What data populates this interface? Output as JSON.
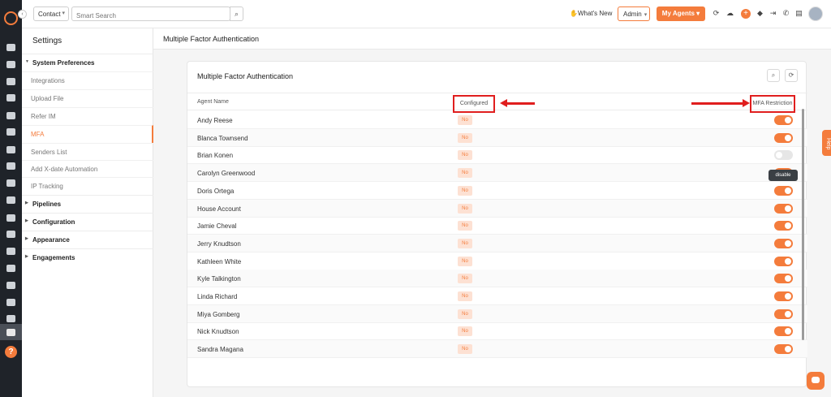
{
  "topbar": {
    "contact_label": "Contact",
    "search_placeholder": "Smart Search",
    "whats_new": "What's New",
    "admin_label": "Admin",
    "my_agents_label": "My Agents"
  },
  "sidebar": {
    "title": "Settings",
    "groups": [
      {
        "label": "System Preferences"
      },
      {
        "label": "Pipelines"
      },
      {
        "label": "Configuration"
      },
      {
        "label": "Appearance"
      },
      {
        "label": "Engagements"
      }
    ],
    "items": [
      {
        "label": "Integrations"
      },
      {
        "label": "Upload File"
      },
      {
        "label": "Refer IM"
      },
      {
        "label": "MFA"
      },
      {
        "label": "Senders List"
      },
      {
        "label": "Add X-date Automation"
      },
      {
        "label": "IP Tracking"
      }
    ]
  },
  "page": {
    "header": "Multiple Factor Authentication",
    "card_title": "Multiple Factor Authentication"
  },
  "table": {
    "headers": {
      "agent": "Agent Name",
      "configured": "Configured",
      "mfa": "MFA Restriction"
    },
    "rows": [
      {
        "name": "Andy Reese",
        "configured": "No",
        "mfa": true
      },
      {
        "name": "Blanca Townsend",
        "configured": "No",
        "mfa": true
      },
      {
        "name": "Brian Konen",
        "configured": "No",
        "mfa": false
      },
      {
        "name": "Carolyn Greenwood",
        "configured": "No",
        "mfa": true
      },
      {
        "name": "Doris Ortega",
        "configured": "No",
        "mfa": true
      },
      {
        "name": "House Account",
        "configured": "No",
        "mfa": true
      },
      {
        "name": "Jamie Cheval",
        "configured": "No",
        "mfa": true
      },
      {
        "name": "Jerry Knudtson",
        "configured": "No",
        "mfa": true
      },
      {
        "name": "Kathleen White",
        "configured": "No",
        "mfa": true
      },
      {
        "name": "Kyle Talkington",
        "configured": "No",
        "mfa": true
      },
      {
        "name": "Linda Richard",
        "configured": "No",
        "mfa": true
      },
      {
        "name": "Miya Gomberg",
        "configured": "No",
        "mfa": true
      },
      {
        "name": "Nick Knudtson",
        "configured": "No",
        "mfa": true
      },
      {
        "name": "Sandra Magana",
        "configured": "No",
        "mfa": true
      }
    ],
    "tooltip": "disable"
  },
  "help_tab": "Help",
  "colors": {
    "accent": "#f47c3c",
    "annotation": "#e01e1e",
    "rail": "#1f2329"
  }
}
